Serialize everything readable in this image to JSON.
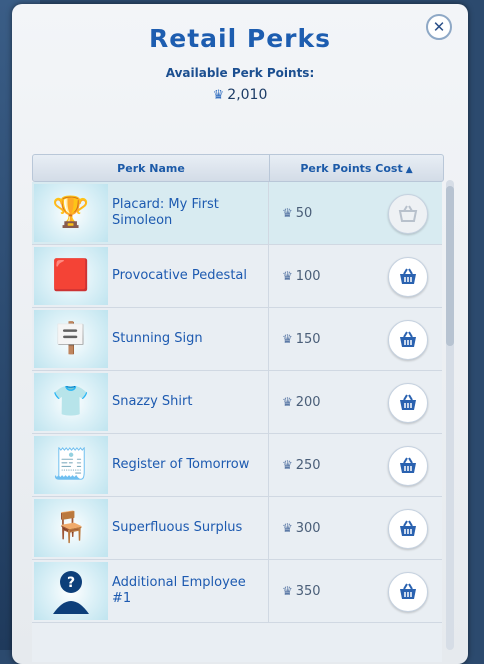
{
  "window": {
    "title": "Retail Perks",
    "points_label": "Available Perk Points:",
    "points_value": "2,010"
  },
  "table": {
    "columns": [
      "Perk Name",
      "Perk Points Cost"
    ],
    "sort": "ascending",
    "rows": [
      {
        "name": "Placard: My First Simoleon",
        "cost": "50",
        "icon": "placard-icon",
        "purchasable": false
      },
      {
        "name": "Provocative Pedestal",
        "cost": "100",
        "icon": "pedestal-icon",
        "purchasable": true
      },
      {
        "name": "Stunning Sign",
        "cost": "150",
        "icon": "sign-icon",
        "purchasable": true
      },
      {
        "name": "Snazzy Shirt",
        "cost": "200",
        "icon": "shirt-icon",
        "purchasable": true
      },
      {
        "name": "Register of Tomorrow",
        "cost": "250",
        "icon": "register-icon",
        "purchasable": true
      },
      {
        "name": "Superfluous Surplus",
        "cost": "300",
        "icon": "surplus-icon",
        "purchasable": true
      },
      {
        "name": "Additional Employee #1",
        "cost": "350",
        "icon": "employee-icon",
        "purchasable": true
      }
    ]
  },
  "colors": {
    "accent": "#1d5db0",
    "panel": "#eef1f5",
    "selected_row": "#d8ebf1"
  }
}
